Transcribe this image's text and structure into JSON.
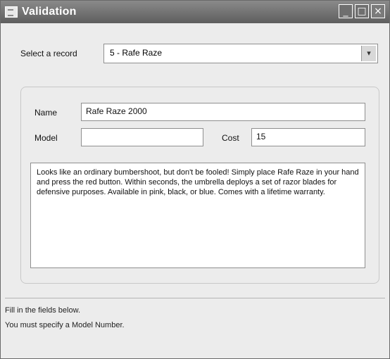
{
  "window": {
    "title": "Validation",
    "controls": {
      "minimize": "_",
      "maximize": "□",
      "close": "×"
    }
  },
  "selector": {
    "label": "Select a record",
    "value": "5 - Rafe Raze",
    "arrow": "▾"
  },
  "form": {
    "name_label": "Name",
    "name_value": "Rafe Raze 2000",
    "model_label": "Model",
    "model_value": "",
    "cost_label": "Cost",
    "cost_value": "15",
    "description": "Looks like an ordinary bumbershoot, but don't be fooled! Simply place Rafe Raze in your hand and press the red button. Within seconds, the umbrella deploys a set of razor blades for defensive purposes. Available in pink, black, or blue. Comes with a lifetime warranty."
  },
  "status": {
    "line1": "Fill in the fields below.",
    "line2": "You must specify a Model Number."
  }
}
